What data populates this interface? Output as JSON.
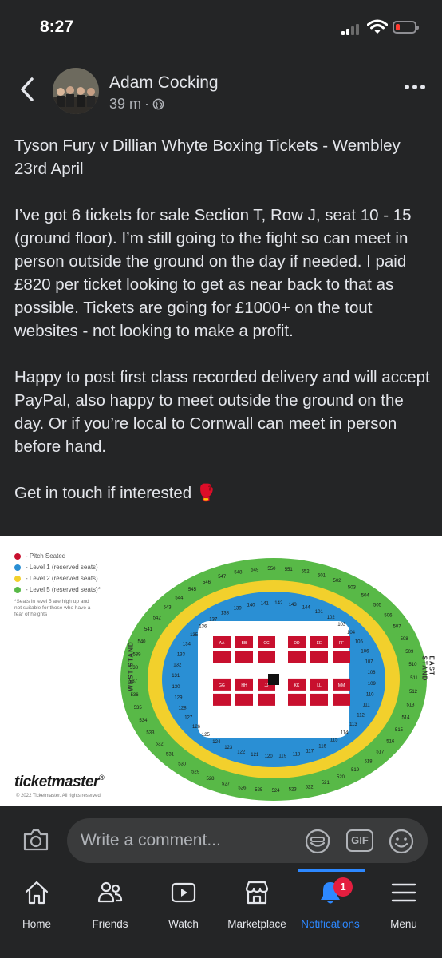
{
  "status_bar": {
    "time": "8:27"
  },
  "post": {
    "author": "Adam Cocking",
    "timestamp": "39 m",
    "separator": "·",
    "paragraphs": [
      "Tyson Fury v Dillian Whyte Boxing Tickets - Wembley 23rd April",
      "I’ve got 6 tickets for sale Section T, Row J, seat 10 - 15 (ground floor). I’m still going to the fight so can meet in person outside the ground on the day if needed. I paid £820 per ticket looking to get as near back to that as possible. Tickets are going for £1000+ on the tout websites - not looking to make a profit.",
      "Happy to post first class recorded delivery and will accept PayPal, also happy to meet outside the ground on the day. Or if you’re local to Cornwall can meet in person before hand.",
      "Get in touch if interested 🥊"
    ]
  },
  "seat_map": {
    "legend": [
      {
        "label": "- Pitch Seated",
        "color": "#c8102e"
      },
      {
        "label": "- Level 1 (reserved seats)",
        "color": "#2a8fd4"
      },
      {
        "label": "- Level 2 (reserved seats)",
        "color": "#f2d02c"
      },
      {
        "label": "- Level 5 (reserved seats)*",
        "color": "#58b947"
      }
    ],
    "note": "*Seats in level 5 are high up and not suitable for those who have a fear of heights",
    "west_stand": "WEST STAND",
    "east_stand": "EAST STAND",
    "brand": "ticketmaster",
    "brand_mark": "®",
    "copyright": "© 2022 Ticketmaster. All rights reserved.",
    "level5_sections": [
      "547",
      "548",
      "549",
      "550",
      "551",
      "552",
      "501",
      "502",
      "503",
      "504",
      "505",
      "506",
      "507",
      "508",
      "509",
      "510",
      "511",
      "512",
      "513",
      "514",
      "515",
      "516",
      "517",
      "518",
      "519",
      "520",
      "521",
      "522",
      "523",
      "524",
      "525",
      "526",
      "527",
      "528",
      "529",
      "530",
      "531",
      "532",
      "533",
      "534",
      "535",
      "536",
      "537",
      "538",
      "539",
      "540",
      "541",
      "542",
      "543",
      "544",
      "545",
      "546"
    ],
    "level1_sections": [
      "139",
      "140",
      "141",
      "142",
      "143",
      "144",
      "101",
      "102",
      "103",
      "104",
      "105",
      "106",
      "107",
      "108",
      "109",
      "110",
      "111",
      "112",
      "113",
      "114",
      "115",
      "116",
      "117",
      "118",
      "119",
      "120",
      "121",
      "122",
      "123",
      "124",
      "125",
      "126",
      "127",
      "128",
      "129",
      "130",
      "131",
      "132",
      "133",
      "134",
      "135",
      "136",
      "137",
      "138"
    ],
    "pitch_blocks": [
      "AA",
      "BB",
      "CC",
      "DD",
      "EE",
      "FF",
      "GG",
      "HH",
      "JJ",
      "KK",
      "LL",
      "MM"
    ]
  },
  "comment_bar": {
    "placeholder": "Write a comment...",
    "gif_label": "GIF"
  },
  "tabs": [
    {
      "label": "Home",
      "icon": "home-icon"
    },
    {
      "label": "Friends",
      "icon": "friends-icon"
    },
    {
      "label": "Watch",
      "icon": "watch-icon"
    },
    {
      "label": "Marketplace",
      "icon": "marketplace-icon"
    },
    {
      "label": "Notifications",
      "icon": "bell-icon",
      "active": true,
      "badge": "1"
    },
    {
      "label": "Menu",
      "icon": "menu-icon"
    }
  ],
  "colors": {
    "accent": "#2d88ff",
    "badge": "#e41e3f",
    "background": "#242526"
  }
}
